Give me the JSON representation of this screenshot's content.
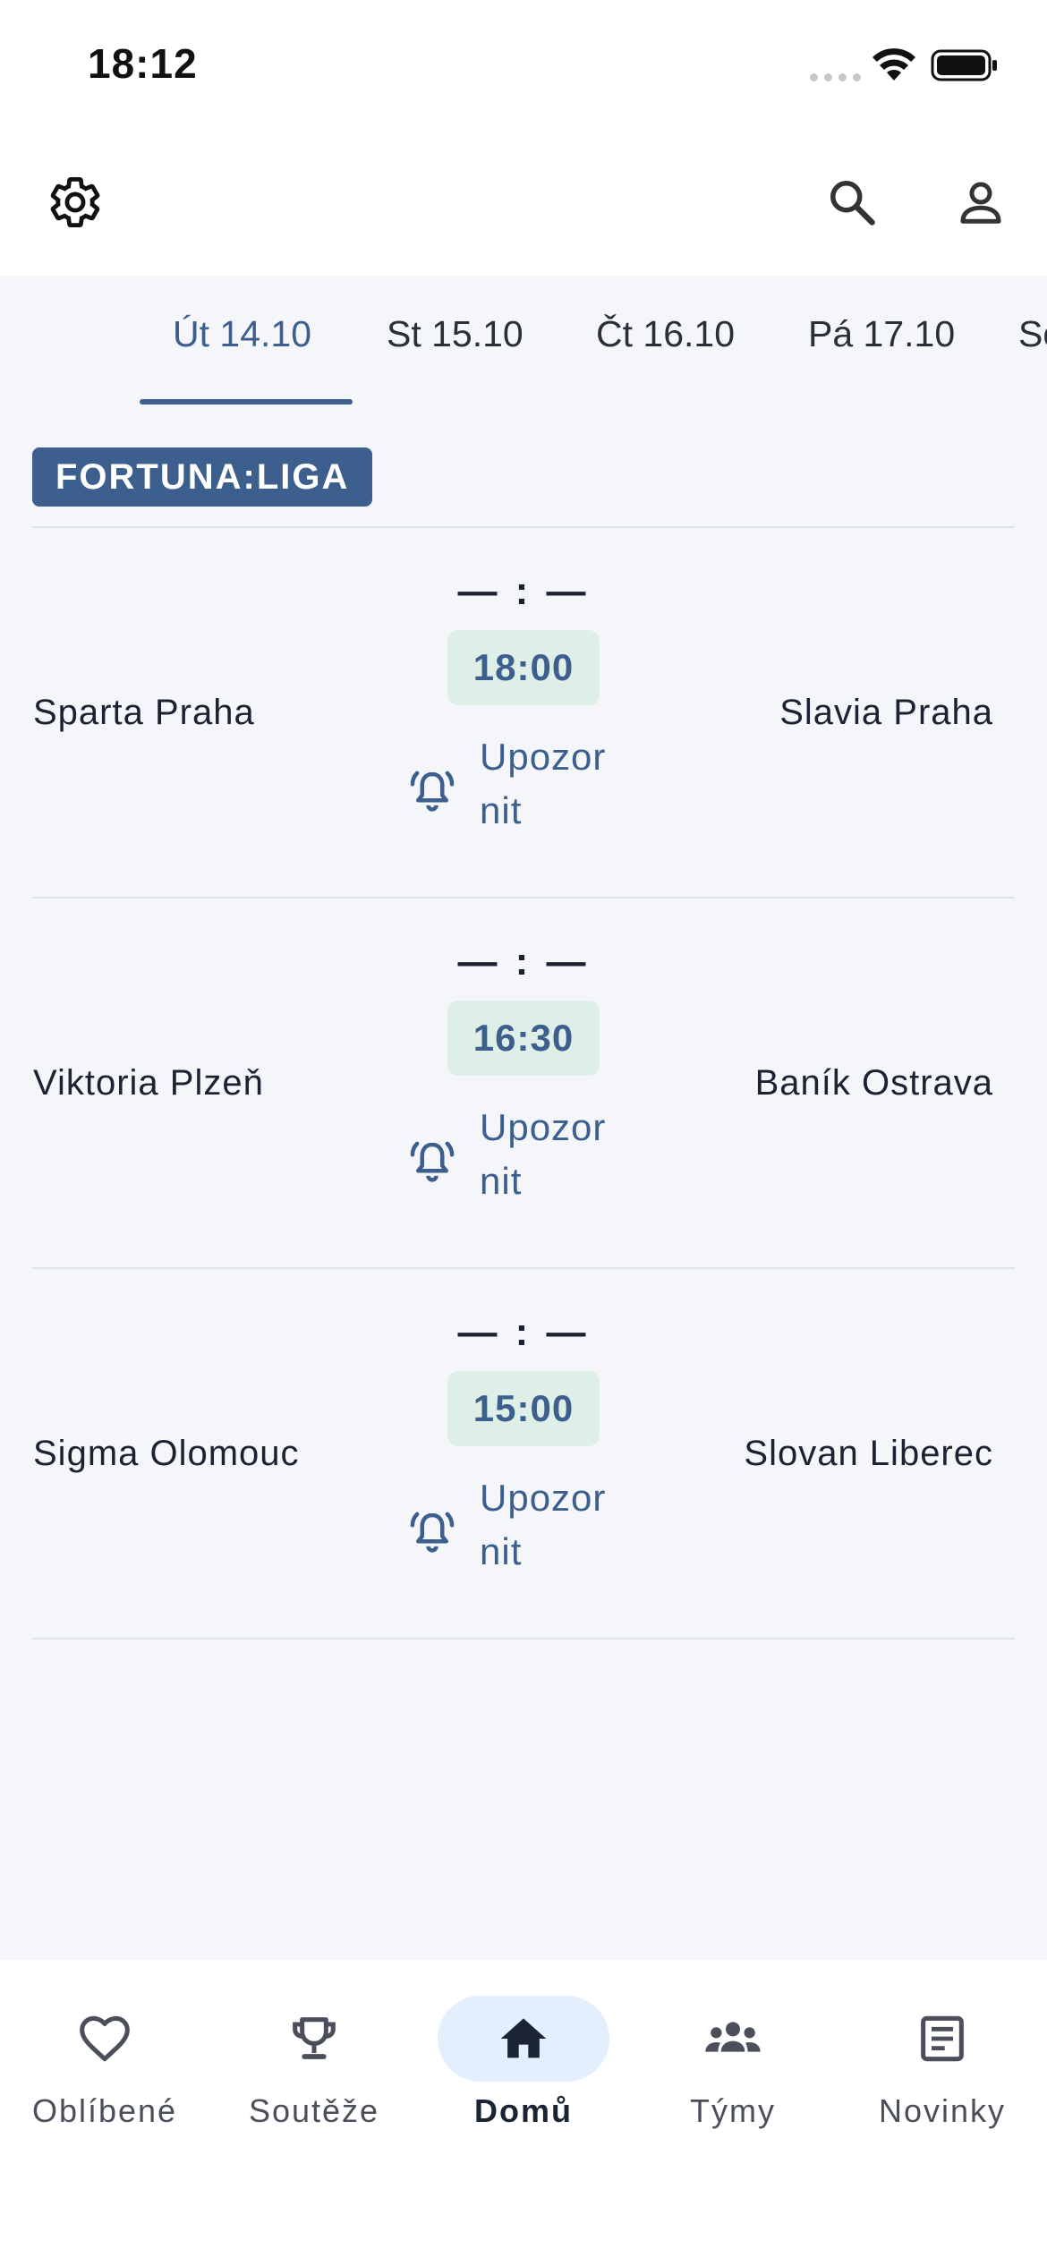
{
  "status_bar": {
    "time": "18:12"
  },
  "toolbar": {
    "settings_icon": "gear-icon",
    "search_icon": "search-icon",
    "account_icon": "person-icon"
  },
  "date_tabs": [
    {
      "label": "Út 14.10",
      "active": true
    },
    {
      "label": "St 15.10",
      "active": false
    },
    {
      "label": "Čt 16.10",
      "active": false
    },
    {
      "label": "Pá 17.10",
      "active": false
    },
    {
      "label": "So",
      "active": false
    }
  ],
  "league": {
    "name": "FORTUNA:LIGA"
  },
  "matches": [
    {
      "home": "Sparta Praha",
      "away": "Slavia Praha",
      "score": "— : —",
      "time": "18:00",
      "notify_label": "Upozornit"
    },
    {
      "home": "Viktoria Plzeň",
      "away": "Baník Ostrava",
      "score": "— : —",
      "time": "16:30",
      "notify_label": "Upozornit"
    },
    {
      "home": "Sigma Olomouc",
      "away": "Slovan Liberec",
      "score": "— : —",
      "time": "15:00",
      "notify_label": "Upozornit"
    }
  ],
  "bottom_nav": [
    {
      "label": "Oblíbené",
      "icon": "heart-icon",
      "active": false
    },
    {
      "label": "Soutěže",
      "icon": "trophy-icon",
      "active": false
    },
    {
      "label": "Domů",
      "icon": "home-icon",
      "active": true
    },
    {
      "label": "Týmy",
      "icon": "groups-icon",
      "active": false
    },
    {
      "label": "Novinky",
      "icon": "article-icon",
      "active": false
    }
  ],
  "colors": {
    "accent": "#3d5f8e",
    "background": "#f4f6fa",
    "kickoff_chip": "#deefe8",
    "nav_active_pill": "#e3effc"
  }
}
